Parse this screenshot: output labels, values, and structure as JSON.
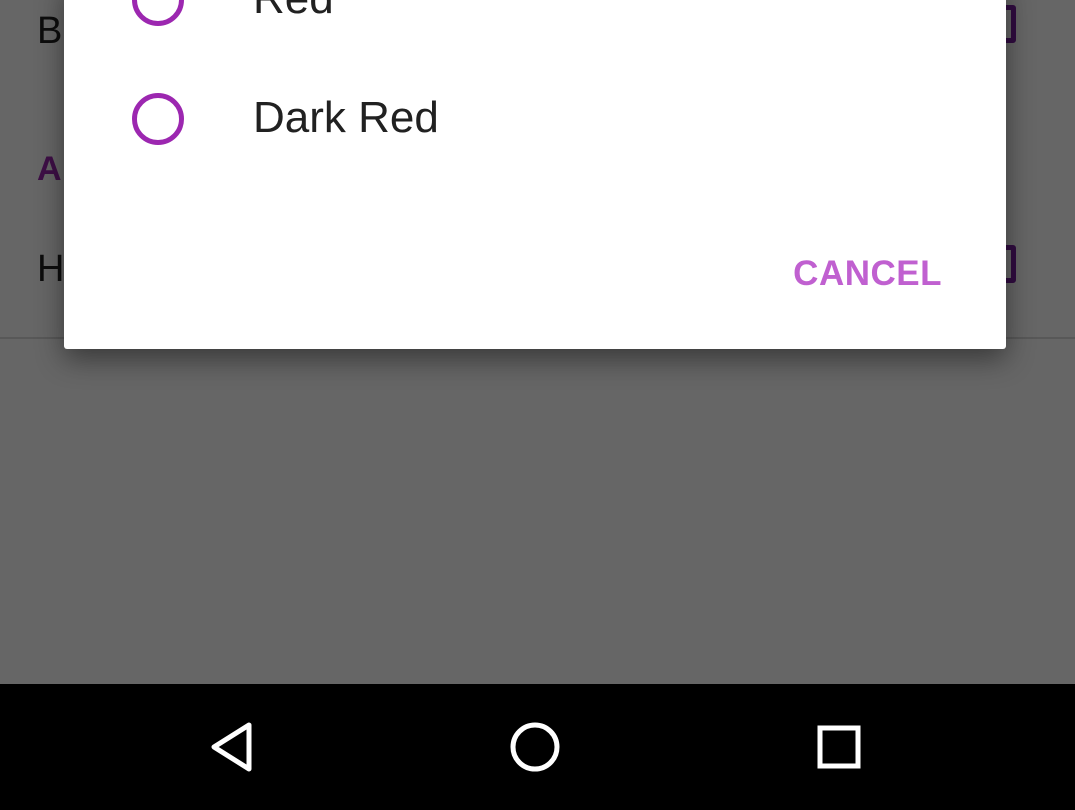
{
  "background_screen": {
    "row1_letter": "B",
    "section_header_letter": "A",
    "row2_letter": "H"
  },
  "dialog": {
    "options": [
      {
        "label": "Red",
        "selected": false
      },
      {
        "label": "Dark Red",
        "selected": false
      }
    ],
    "cancel_label": "CANCEL"
  },
  "colors": {
    "accent": "#9c27b0",
    "cancel_text": "#c060d0",
    "scrim": "rgba(0,0,0,0.6)",
    "navbar": "#000000"
  },
  "navbar": {
    "icons": [
      "back-icon",
      "home-icon",
      "recents-icon"
    ]
  }
}
